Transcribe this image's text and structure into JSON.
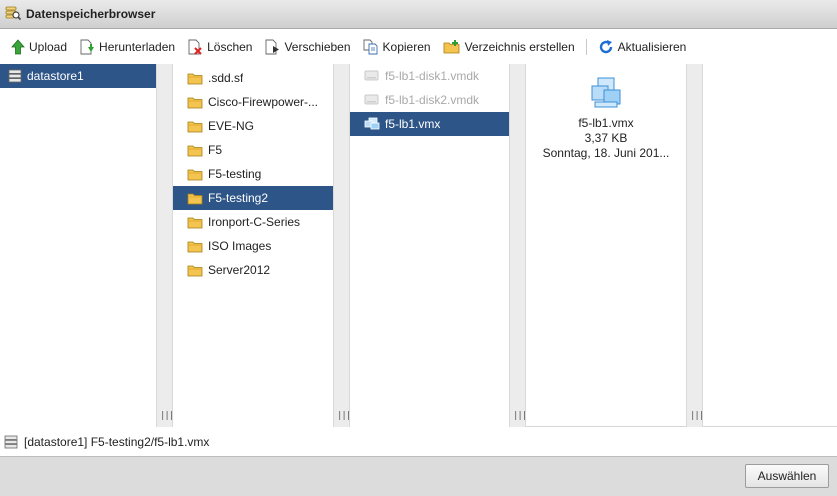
{
  "window": {
    "title": "Datenspeicherbrowser",
    "icon": "datastore-search-icon"
  },
  "toolbar": {
    "upload": "Upload",
    "download": "Herunterladen",
    "delete": "Löschen",
    "move": "Verschieben",
    "copy": "Kopieren",
    "create_dir": "Verzeichnis erstellen",
    "refresh": "Aktualisieren"
  },
  "datastores": [
    {
      "label": "datastore1",
      "selected": true
    }
  ],
  "folders": [
    {
      "label": ".sdd.sf"
    },
    {
      "label": "Cisco-Firewpower-..."
    },
    {
      "label": "EVE-NG"
    },
    {
      "label": "F5"
    },
    {
      "label": "F5-testing"
    },
    {
      "label": "F5-testing2",
      "selected": true
    },
    {
      "label": "Ironport-C-Series"
    },
    {
      "label": "ISO Images"
    },
    {
      "label": "Server2012"
    }
  ],
  "files": [
    {
      "label": "f5-lb1-disk1.vmdk",
      "type": "vmdk",
      "disabled": true
    },
    {
      "label": "f5-lb1-disk2.vmdk",
      "type": "vmdk",
      "disabled": true
    },
    {
      "label": "f5-lb1.vmx",
      "type": "vmx",
      "selected": true
    }
  ],
  "preview": {
    "name": "f5-lb1.vmx",
    "size": "3,37 KB",
    "date": "Sonntag, 18. Juni 201..."
  },
  "path": "[datastore1] F5-testing2/f5-lb1.vmx",
  "footer": {
    "select_label": "Auswählen"
  },
  "colors": {
    "selection": "#2e5587",
    "folder": "#f3c44f",
    "toolbar_green": "#2e9e2e",
    "refresh_blue": "#1f6fd1"
  }
}
